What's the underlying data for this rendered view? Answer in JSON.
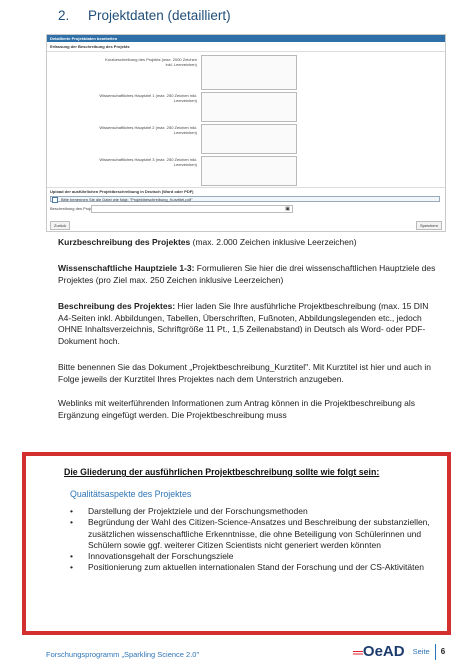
{
  "heading": {
    "number": "2.",
    "title": "Projektdaten (detailliert)"
  },
  "form": {
    "header": "Detaillierte Projektdaten bearbeiten",
    "section_title": "Erfassung der Beschreibung des Projekts",
    "fields": [
      {
        "label": "Kurzbeschreibung des Projekts (max. 2000 Zeichen inkl. Leerzeichen)"
      },
      {
        "label": "Wissenschaftliches Hauptziel 1 (max. 250 Zeichen inkl. Leerzeichen)"
      },
      {
        "label": "Wissenschaftliches Hauptziel 2 (max. 250 Zeichen inkl. Leerzeichen)"
      },
      {
        "label": "Wissenschaftliches Hauptziel 3 (max. 250 Zeichen inkl. Leerzeichen)"
      }
    ],
    "upload_label": "Upload der ausführlichen Projektbeschreibung in Deutsch (Word oder PDF)",
    "upload_hint": "Bitte benennen Sie die Datei wie folgt: \"Projektbeschreibung_Kurztitel.pdf\"",
    "beschreibung_label": "Beschreibung des Projekts",
    "back_button": "Zurück",
    "save_button": "Speichern"
  },
  "paragraphs": {
    "p1_bold": "Kurzbeschreibung des Projektes",
    "p1_text": " (max. 2.000 Zeichen inklusive Leerzeichen)",
    "p2_bold": "Wissenschaftliche Hauptziele 1-3:",
    "p2_text": " Formulieren Sie hier die drei wissenschaftlichen Hauptziele des Projektes (pro Ziel max. 250 Zeichen inklusive Leerzeichen)",
    "p3_bold": "Beschreibung des Projektes:",
    "p3_text": " Hier laden Sie Ihre ausführliche Projektbeschreibung (max. 15 DIN A4-Seiten inkl. Abbildungen, Tabellen, Überschriften, Fußnoten, Abbildungslegenden etc., jedoch OHNE Inhaltsverzeichnis, Schriftgröße 11 Pt., 1,5 Zeilenabstand) in Deutsch als Word- oder PDF-Dokument hoch.",
    "p4": "Bitte benennen Sie das Dokument „Projektbeschreibung_Kurztitel\". Mit Kurztitel ist hier und auch in Folge jeweils der Kurztitel Ihres Projektes nach dem Unterstrich anzugeben.",
    "p5": "Weblinks mit weiterführenden Informationen zum Antrag können in die Projektbeschreibung als Ergänzung eingefügt werden. Die Projektbeschreibung muss"
  },
  "outline": {
    "title": "Die Gliederung der ausführlichen Projektbeschreibung sollte wie folgt sein:",
    "subtitle": "Qualitätsaspekte des Projektes",
    "items": [
      "Darstellung der Projektziele und der Forschungsmethoden",
      "Begründung der Wahl des Citizen-Science-Ansatzes und Beschreibung der substanziellen, zusätzlichen wissenschaftliche Erkenntnisse, die ohne Beteiligung von Schülerinnen und Schülern sowie ggf. weiterer Citizen Scientists nicht generiert werden könnten",
      "Innovationsgehalt der Forschungsziele",
      "Positionierung zum aktuellen internationalen Stand der Forschung und der CS-Aktivitäten"
    ]
  },
  "footer": {
    "program": "Forschungsprogramm „Sparkling Science 2.0\"",
    "logo": "OeAD",
    "page_label": "Seite",
    "page_number": "6"
  }
}
